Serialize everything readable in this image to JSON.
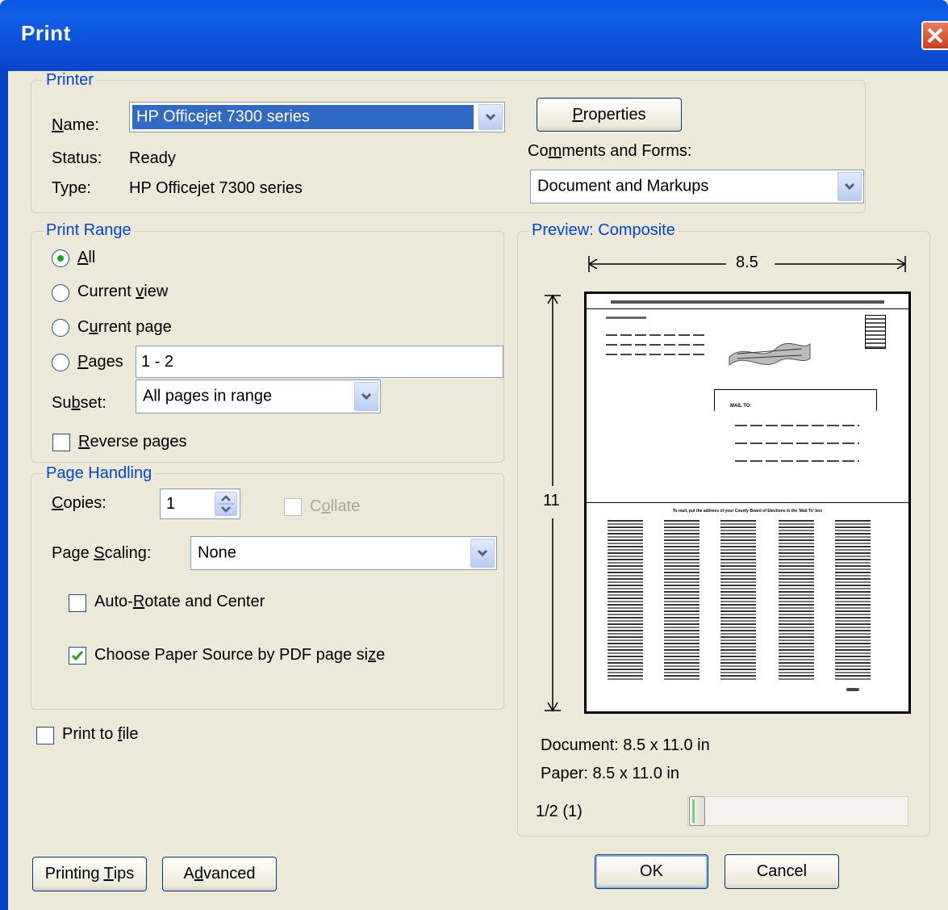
{
  "window": {
    "title": "Print"
  },
  "printer": {
    "group_label": "Printer",
    "name_label": "Name:",
    "name_value": "HP Officejet 7300 series",
    "status_label": "Status:",
    "status_value": "Ready",
    "type_label": "Type:",
    "type_value": "HP Officejet 7300 series",
    "properties_button": "Properties",
    "comments_label": "Comments and Forms:",
    "comments_value": "Document and Markups"
  },
  "print_range": {
    "group_label": "Print Range",
    "all_label": "All",
    "current_view_label": "Current view",
    "current_page_label": "Current page",
    "pages_label": "Pages",
    "pages_value": "1 - 2",
    "subset_label": "Subset:",
    "subset_value": "All pages in range",
    "reverse_label": "Reverse pages",
    "selected": "All"
  },
  "page_handling": {
    "group_label": "Page Handling",
    "copies_label": "Copies:",
    "copies_value": "1",
    "collate_label": "Collate",
    "scaling_label": "Page Scaling:",
    "scaling_value": "None",
    "auto_rotate_label": "Auto-Rotate and Center",
    "auto_rotate_checked": false,
    "paper_source_label": "Choose Paper Source by PDF page size",
    "paper_source_checked": true
  },
  "print_to_file": {
    "label": "Print to file",
    "checked": false
  },
  "preview": {
    "group_label": "Preview: Composite",
    "width_label": "8.5",
    "height_label": "11",
    "document_size": "Document: 8.5 x 11.0 in",
    "paper_size": "Paper: 8.5 x 11.0 in",
    "page_indicator": "1/2 (1)",
    "page_text_top": "MAIL TO:",
    "page_text_bottom": "To mail, put the address of your County Board of Elections in the 'Mail To' box"
  },
  "buttons": {
    "printing_tips": "Printing Tips",
    "advanced": "Advanced",
    "ok": "OK",
    "cancel": "Cancel"
  },
  "colors": {
    "title_bar": "#0a44c9",
    "group_label": "#0046d5",
    "dialog_bg": "#ece9d8"
  }
}
